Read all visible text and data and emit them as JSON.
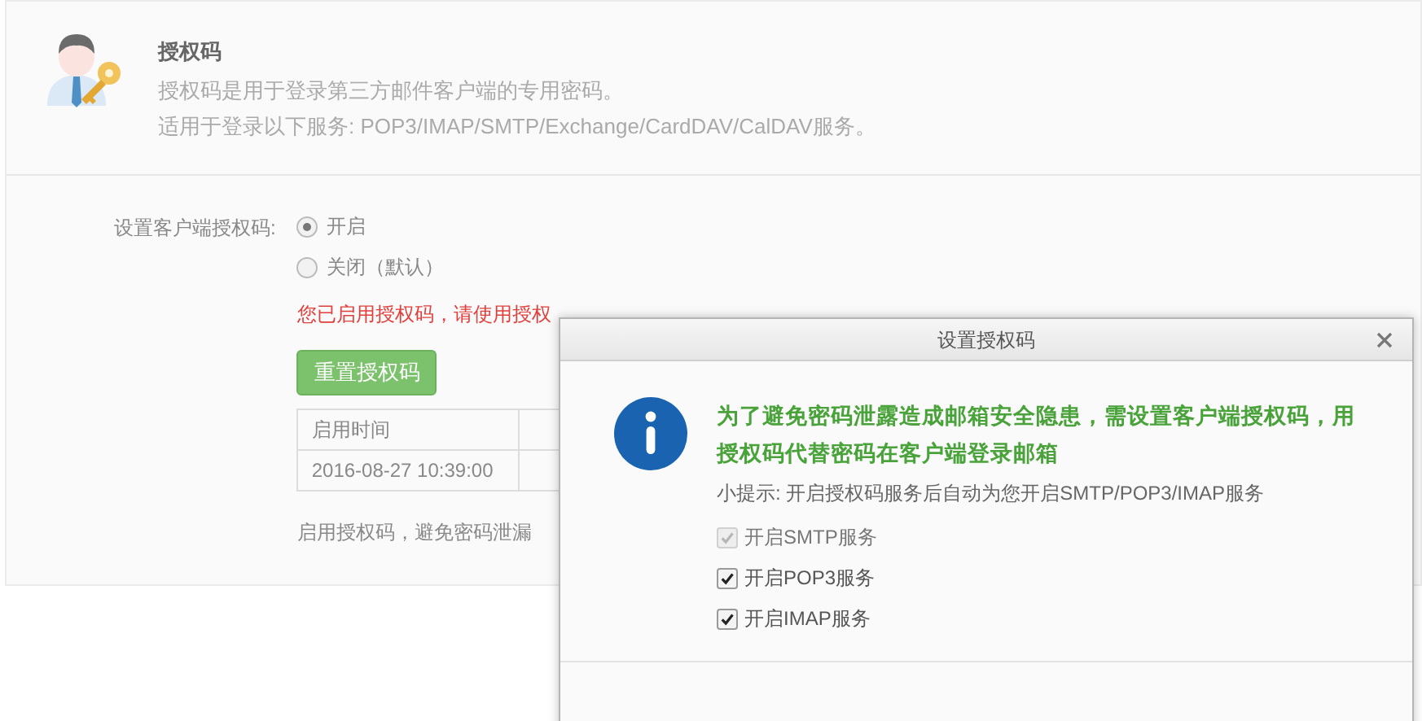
{
  "header": {
    "title": "授权码",
    "lines": [
      "授权码是用于登录第三方邮件客户端的专用密码。",
      "适用于登录以下服务: POP3/IMAP/SMTP/Exchange/CardDAV/CalDAV服务。"
    ]
  },
  "settings": {
    "label": "设置客户端授权码:",
    "options": [
      {
        "label": "开启",
        "selected": true
      },
      {
        "label": "关闭（默认）",
        "selected": false
      }
    ],
    "notice": "您已启用授权码，请使用授权",
    "reset_button": "重置授权码",
    "table": {
      "columns": [
        "启用时间"
      ],
      "rows": [
        [
          "2016-08-27 10:39:00"
        ]
      ]
    },
    "footer_note": "启用授权码，避免密码泄漏"
  },
  "dialog": {
    "title": "设置授权码",
    "message": "为了避免密码泄露造成邮箱安全隐患，需设置客户端授权码，用授权码代替密码在客户端登录邮箱",
    "tip": "小提示: 开启授权码服务后自动为您开启SMTP/POP3/IMAP服务",
    "services": [
      {
        "label": "开启SMTP服务",
        "checked": true,
        "disabled": true
      },
      {
        "label": "开启POP3服务",
        "checked": true,
        "disabled": false
      },
      {
        "label": "开启IMAP服务",
        "checked": true,
        "disabled": false
      }
    ]
  }
}
